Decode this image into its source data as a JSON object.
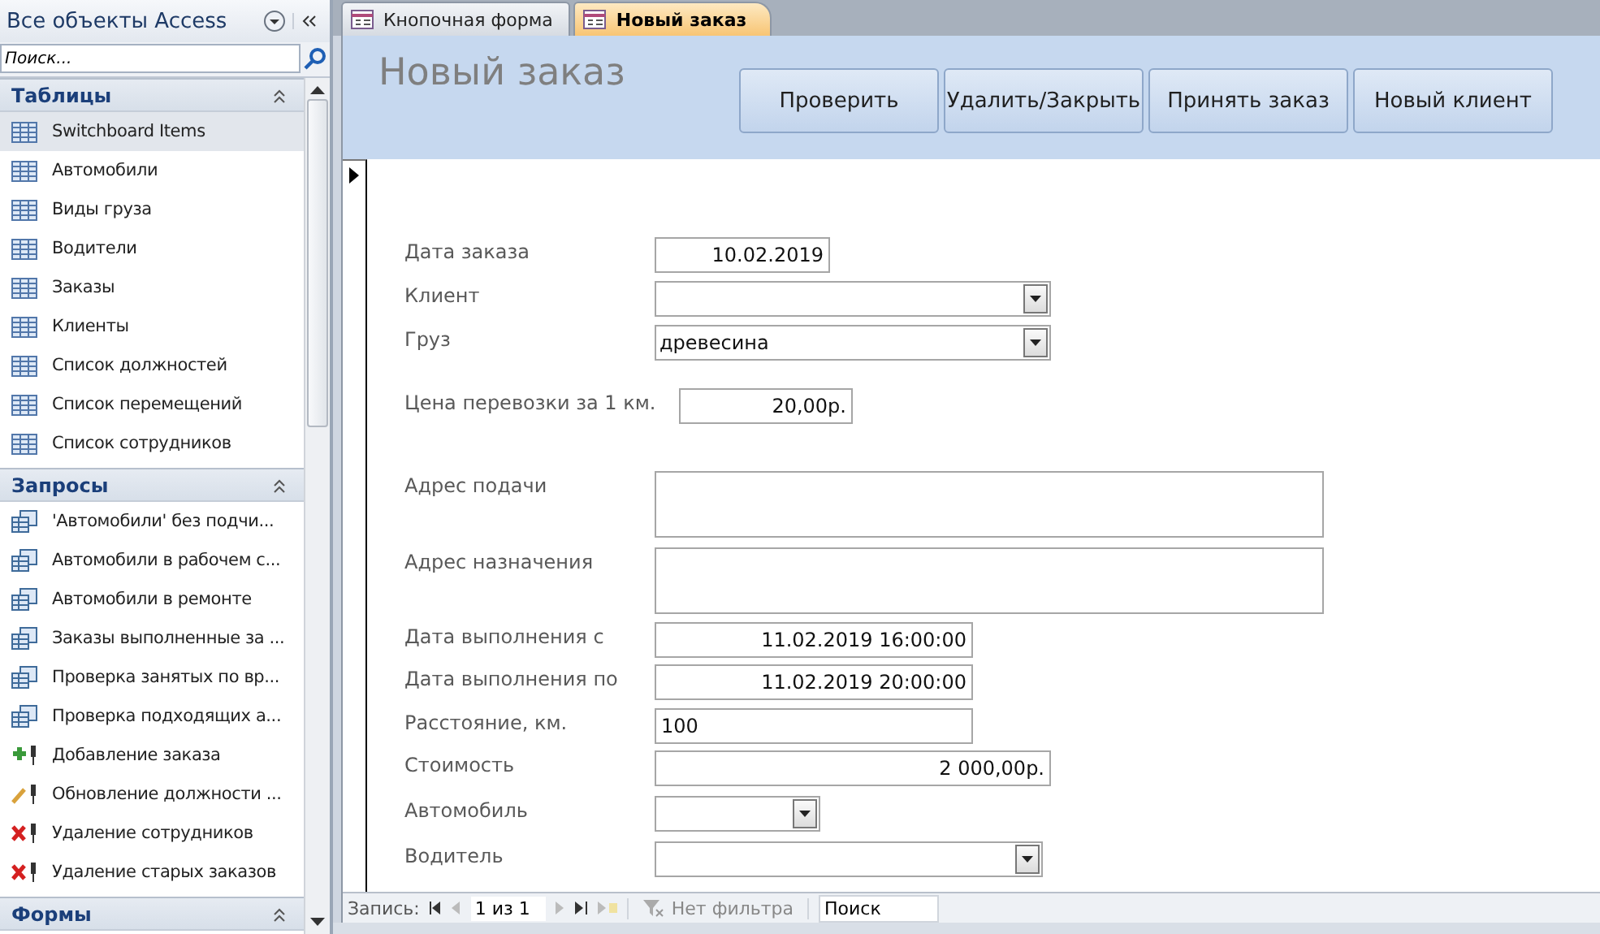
{
  "nav_pane": {
    "title": "Все объекты Access",
    "search": {
      "placeholder": "Поиск..."
    },
    "groups": [
      {
        "title": "Таблицы",
        "items": [
          {
            "label": "Switchboard Items",
            "kind": "table",
            "selected": true
          },
          {
            "label": "Автомобили",
            "kind": "table",
            "selected": false
          },
          {
            "label": "Виды груза",
            "kind": "table",
            "selected": false
          },
          {
            "label": "Водители",
            "kind": "table",
            "selected": false
          },
          {
            "label": "Заказы",
            "kind": "table",
            "selected": false
          },
          {
            "label": "Клиенты",
            "kind": "table",
            "selected": false
          },
          {
            "label": "Список должностей",
            "kind": "table",
            "selected": false
          },
          {
            "label": "Список перемещений",
            "kind": "table",
            "selected": false
          },
          {
            "label": "Список сотрудников",
            "kind": "table",
            "selected": false
          }
        ]
      },
      {
        "title": "Запросы",
        "items": [
          {
            "label": "'Автомобили' без подчи...",
            "kind": "select",
            "selected": false
          },
          {
            "label": "Автомобили в рабочем с...",
            "kind": "select",
            "selected": false
          },
          {
            "label": "Автомобили в ремонте",
            "kind": "select",
            "selected": false
          },
          {
            "label": "Заказы выполненные за ...",
            "kind": "select",
            "selected": false
          },
          {
            "label": "Проверка занятых по вр...",
            "kind": "select",
            "selected": false
          },
          {
            "label": "Проверка подходящих а...",
            "kind": "select",
            "selected": false
          },
          {
            "label": "Добавление заказа",
            "kind": "append",
            "selected": false
          },
          {
            "label": "Обновление должности ...",
            "kind": "update",
            "selected": false
          },
          {
            "label": "Удаление сотрудников",
            "kind": "delete",
            "selected": false
          },
          {
            "label": "Удаление старых заказов",
            "kind": "delete",
            "selected": false
          }
        ]
      },
      {
        "title": "Формы"
      }
    ]
  },
  "tabs": [
    {
      "label": "Кнопочная форма",
      "selected": false
    },
    {
      "label": "Новый заказ",
      "selected": true
    }
  ],
  "form": {
    "title": "Новый заказ",
    "buttons": [
      "Проверить",
      "Удалить/Закрыть",
      "Принять заказ",
      "Новый клиент"
    ],
    "fields": [
      {
        "label": "Дата заказа",
        "kind": "number",
        "value": "10.02.2019"
      },
      {
        "label": "Клиент",
        "kind": "combo"
      },
      {
        "label": "Груз",
        "kind": "combo",
        "value": "древесина"
      },
      {
        "label": "Цена перевозки за 1 км.",
        "kind": "number",
        "value": "20,00р."
      },
      {
        "label": "Адрес подачи",
        "kind": "memo"
      },
      {
        "label": "Адрес назначения",
        "kind": "memo"
      },
      {
        "label": "Дата выполнения с",
        "kind": "number",
        "value": "11.02.2019 16:00:00"
      },
      {
        "label": "Дата выполнения по",
        "kind": "number",
        "value": "11.02.2019 20:00:00"
      },
      {
        "label": "Расстояние, км.",
        "kind": "text",
        "value": "100"
      },
      {
        "label": "Стоимость",
        "kind": "number",
        "value": "2 000,00р."
      },
      {
        "label": "Автомобиль",
        "kind": "combo"
      },
      {
        "label": "Водитель",
        "kind": "combo"
      }
    ]
  },
  "record_nav": {
    "label": "Запись:",
    "position": "1 из 1",
    "filter": "Нет фильтра",
    "search": {
      "placeholder": "Поиск"
    }
  }
}
